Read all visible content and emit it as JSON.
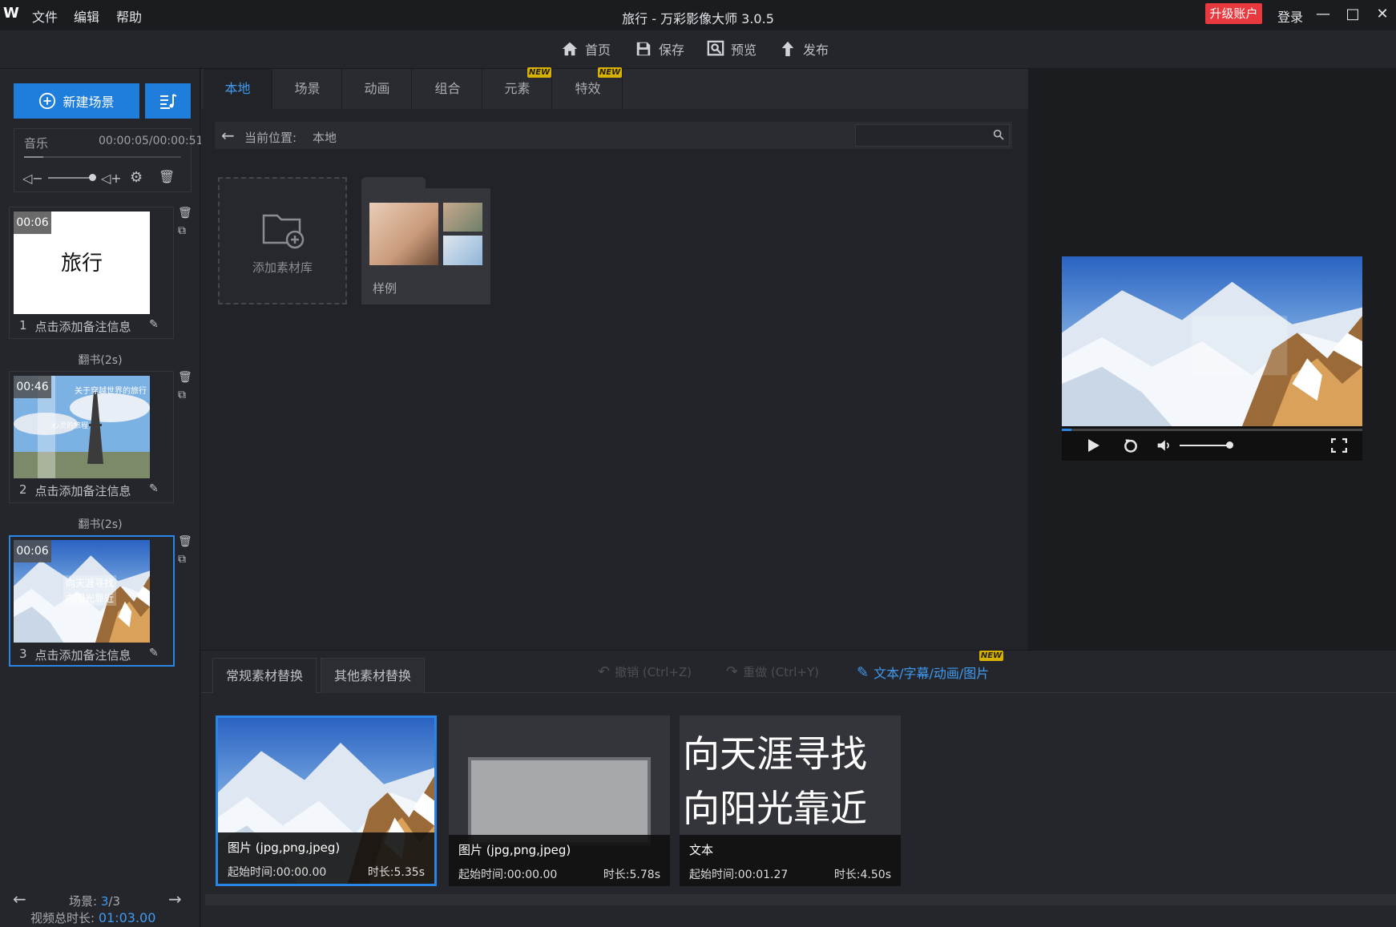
{
  "titlebar": {
    "logo": "W",
    "menu": [
      "文件",
      "编辑",
      "帮助"
    ],
    "title": "旅行 - 万彩影像大师 3.0.5",
    "upgrade": "升级账户",
    "login": "登录",
    "controls": [
      "—",
      "□",
      "✕"
    ]
  },
  "toolbar": {
    "home": "首页",
    "save": "保存",
    "preview": "预览",
    "publish": "发布"
  },
  "left": {
    "new_scene": "新建场景",
    "music_label": "音乐",
    "music_time": "00:00:05/00:00:51",
    "scenes": [
      {
        "time": "00:06",
        "index": "1",
        "note": "点击添加备注信息",
        "title": "旅行"
      },
      {
        "time": "00:46",
        "index": "2",
        "note": "点击添加备注信息",
        "caption": "关于穿越世界的旅行",
        "caption2": "心灵的旅程"
      },
      {
        "time": "00:06",
        "index": "3",
        "note": "点击添加备注信息",
        "caption": "向天涯寻找",
        "caption2": "向阳光靠近"
      }
    ],
    "transitions": [
      "翻书(2s)",
      "翻书(2s)"
    ],
    "scene_counter_label": "场景:",
    "scene_current": "3",
    "scene_total": "/3",
    "total_duration_label": "视频总时长:",
    "total_duration": "01:03.00"
  },
  "library": {
    "tabs": [
      "本地",
      "场景",
      "动画",
      "组合",
      "元素",
      "特效"
    ],
    "new_badge": "NEW",
    "path_label": "当前位置:",
    "path_value": "本地",
    "search_placeholder": "",
    "add_library": "添加素材库",
    "sample_folder": "样例"
  },
  "bottom": {
    "tabs": [
      "常规素材替换",
      "其他素材替换"
    ],
    "undo": "撤销 (Ctrl+Z)",
    "redo": "重做 (Ctrl+Y)",
    "text_edit": "文本/字幕/动画/图片",
    "cards": [
      {
        "type": "图片 (jpg,png,jpeg)",
        "start": "起始时间:00:00.00",
        "duration": "时长:5.35s"
      },
      {
        "type": "图片 (jpg,png,jpeg)",
        "start": "起始时间:00:00.00",
        "duration": "时长:5.78s"
      },
      {
        "type": "文本",
        "start": "起始时间:00:01.27",
        "duration": "时长:4.50s",
        "line1": "向天涯寻找",
        "line2": "向阳光靠近"
      }
    ]
  },
  "colors": {
    "accent": "#1f7ddb",
    "upgrade": "#e8393f",
    "new_badge": "#d7b100"
  }
}
